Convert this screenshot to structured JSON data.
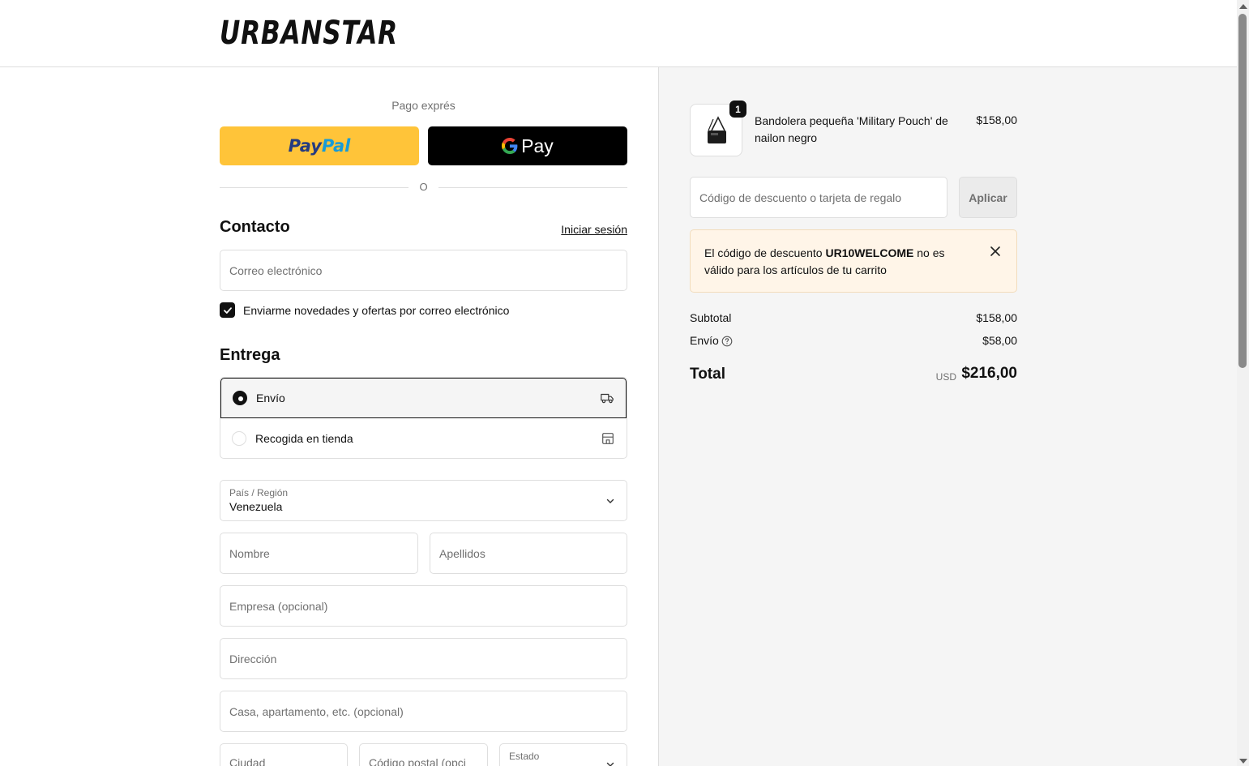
{
  "header": {
    "logo": "URBANSTAR"
  },
  "express": {
    "label": "Pago exprés",
    "paypal_part1": "Pay",
    "paypal_part2": "Pal",
    "gpay_label": "Pay",
    "divider": "O"
  },
  "contact": {
    "title": "Contacto",
    "login_link": "Iniciar sesión",
    "email_placeholder": "Correo electrónico",
    "newsletter_label": "Enviarme novedades y ofertas por correo electrónico",
    "newsletter_checked": true
  },
  "delivery": {
    "title": "Entrega",
    "options": [
      {
        "label": "Envío",
        "selected": true,
        "icon": "truck-icon"
      },
      {
        "label": "Recogida en tienda",
        "selected": false,
        "icon": "store-icon"
      }
    ],
    "country_label": "País / Región",
    "country_value": "Venezuela",
    "first_name_placeholder": "Nombre",
    "last_name_placeholder": "Apellidos",
    "company_placeholder": "Empresa (opcional)",
    "address_placeholder": "Dirección",
    "apartment_placeholder": "Casa, apartamento, etc. (opcional)",
    "city_placeholder": "Ciudad",
    "postal_placeholder": "Código postal (opci",
    "state_label": "Estado"
  },
  "order": {
    "item": {
      "quantity": "1",
      "name": "Bandolera pequeña 'Military Pouch' de nailon negro",
      "price": "$158,00"
    },
    "discount_placeholder": "Código de descuento o tarjeta de regalo",
    "apply_label": "Aplicar",
    "alert": {
      "text_before": "El código de descuento ",
      "code": "UR10WELCOME",
      "text_after": " no es válido para los artículos de tu carrito"
    },
    "subtotal_label": "Subtotal",
    "subtotal_value": "$158,00",
    "shipping_label": "Envío",
    "shipping_value": "$58,00",
    "total_label": "Total",
    "currency": "USD",
    "total_value": "$216,00"
  },
  "colors": {
    "paypal_yellow": "#ffc439",
    "paypal_dark_blue": "#253b80",
    "paypal_light_blue": "#179bd7",
    "alert_bg": "#fff5e8",
    "summary_bg": "#f5f5f5"
  }
}
